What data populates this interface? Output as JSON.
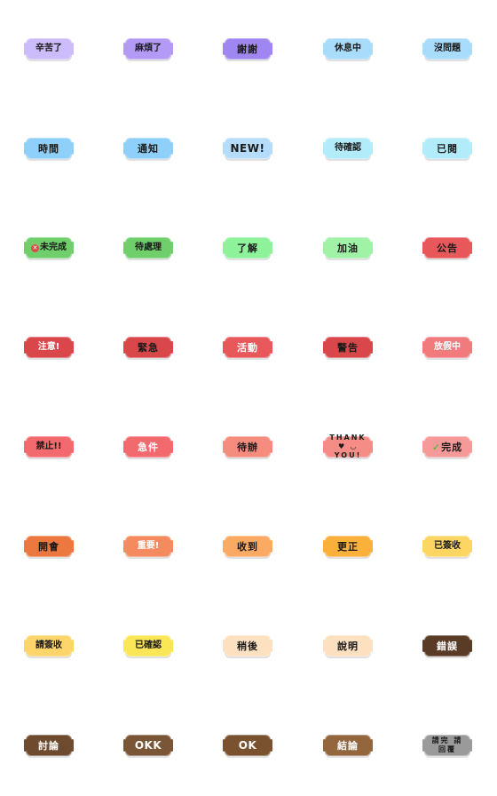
{
  "stickers": [
    {
      "text": "辛苦了",
      "bg": "#cdbcfb",
      "fg": "#1a1a1a"
    },
    {
      "text": "麻煩了",
      "bg": "#b39af6",
      "fg": "#1a1a1a"
    },
    {
      "text": "謝謝",
      "bg": "#9f86f0",
      "fg": "#1a1a1a"
    },
    {
      "text": "休息中",
      "bg": "#a9dbfb",
      "fg": "#1a1a1a"
    },
    {
      "text": "沒問題",
      "bg": "#a9dbfb",
      "fg": "#1a1a1a"
    },
    {
      "text": "時間",
      "bg": "#8fd0fa",
      "fg": "#1a1a1a"
    },
    {
      "text": "通知",
      "bg": "#8fd0fa",
      "fg": "#1a1a1a"
    },
    {
      "text": "NEW!",
      "bg": "#b5ddfb",
      "fg": "#1a1a1a",
      "latin": true
    },
    {
      "text": "待確認",
      "bg": "#b2ecfb",
      "fg": "#1a1a1a"
    },
    {
      "text": "已閱",
      "bg": "#b2ecfb",
      "fg": "#1a1a1a"
    },
    {
      "text": "未完成",
      "bg": "#6fcf6a",
      "fg": "#1a1a1a",
      "icon": "x-icon",
      "icon_glyph": "✕"
    },
    {
      "text": "待處理",
      "bg": "#6fcf6a",
      "fg": "#1a1a1a"
    },
    {
      "text": "了解",
      "bg": "#8ef29a",
      "fg": "#1a1a1a"
    },
    {
      "text": "加油",
      "bg": "#9ff2a6",
      "fg": "#1a1a1a"
    },
    {
      "text": "公告",
      "bg": "#e8585a",
      "fg": "#1a1a1a"
    },
    {
      "text": "注意!",
      "bg": "#d9474a",
      "fg": "#ffffff"
    },
    {
      "text": "緊急",
      "bg": "#d9474a",
      "fg": "#1a1a1a"
    },
    {
      "text": "活動",
      "bg": "#e8585a",
      "fg": "#ffffff"
    },
    {
      "text": "警告",
      "bg": "#d9474a",
      "fg": "#1a1a1a"
    },
    {
      "text": "放假中",
      "bg": "#f07a7c",
      "fg": "#ffffff"
    },
    {
      "text": "禁止!!",
      "bg": "#f26a6d",
      "fg": "#1a1a1a"
    },
    {
      "text": "急件",
      "bg": "#f26a6d",
      "fg": "#ffffff"
    },
    {
      "text": "待辦",
      "bg": "#f58c7e",
      "fg": "#1a1a1a"
    },
    {
      "text": "THANK ♥ ◡ YOU!",
      "bg": "#f58c86",
      "fg": "#1a1a1a",
      "latin_small": true
    },
    {
      "text": "完成",
      "bg": "#f59a98",
      "fg": "#1a1a1a",
      "icon": "check-icon",
      "icon_glyph": "✓"
    },
    {
      "text": "開會",
      "bg": "#ec7840",
      "fg": "#1a1a1a"
    },
    {
      "text": "重要!",
      "bg": "#f48a5e",
      "fg": "#ffffff"
    },
    {
      "text": "收到",
      "bg": "#fbaa63",
      "fg": "#1a1a1a"
    },
    {
      "text": "更正",
      "bg": "#fbb03b",
      "fg": "#1a1a1a"
    },
    {
      "text": "已簽收",
      "bg": "#fdd563",
      "fg": "#1a1a1a"
    },
    {
      "text": "請簽收",
      "bg": "#fdd56b",
      "fg": "#1a1a1a"
    },
    {
      "text": "已確認",
      "bg": "#fbe657",
      "fg": "#1a1a1a"
    },
    {
      "text": "稍後",
      "bg": "#fde0c0",
      "fg": "#1a1a1a"
    },
    {
      "text": "說明",
      "bg": "#fde0c0",
      "fg": "#1a1a1a"
    },
    {
      "text": "錯誤",
      "bg": "#5a3c26",
      "fg": "#ffffff"
    },
    {
      "text": "討論",
      "bg": "#6e4a2e",
      "fg": "#ffffff"
    },
    {
      "text": "OKK",
      "bg": "#7a5536",
      "fg": "#ffffff",
      "latin": true
    },
    {
      "text": "OK",
      "bg": "#7a5230",
      "fg": "#ffffff",
      "latin": true
    },
    {
      "text": "結論",
      "bg": "#93663e",
      "fg": "#ffffff"
    },
    {
      "text": "請完 請回覆",
      "bg": "#9a9a9a",
      "fg": "#1a1a1a",
      "two_line": true
    }
  ]
}
